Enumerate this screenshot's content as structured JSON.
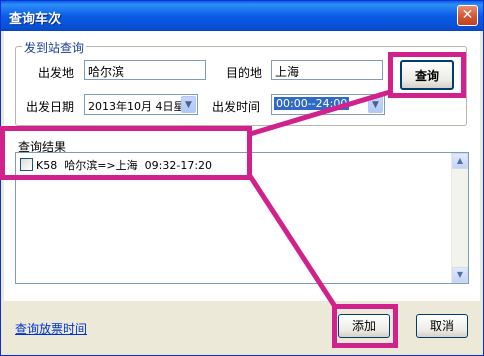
{
  "window": {
    "title": "查询车次",
    "close_glyph": "✕"
  },
  "query_group": {
    "legend": "发到站查询",
    "origin_label": "出发地",
    "origin_value": "哈尔滨",
    "dest_label": "目的地",
    "dest_value": "上海",
    "date_label": "出发日期",
    "date_value": "2013年10月 4日星",
    "time_label": "出发时间",
    "time_value": "00:00--24:00",
    "query_button": "查询"
  },
  "results": {
    "label": "查询结果",
    "rows": [
      {
        "train": "K58",
        "route": "哈尔滨=>上海",
        "time": "09:32-17:20"
      }
    ]
  },
  "footer": {
    "link": "查询放票时间",
    "add_button": "添加",
    "cancel_button": "取消"
  },
  "colors": {
    "title_bar": "#0a5fe6",
    "highlight": "#d0218c"
  }
}
